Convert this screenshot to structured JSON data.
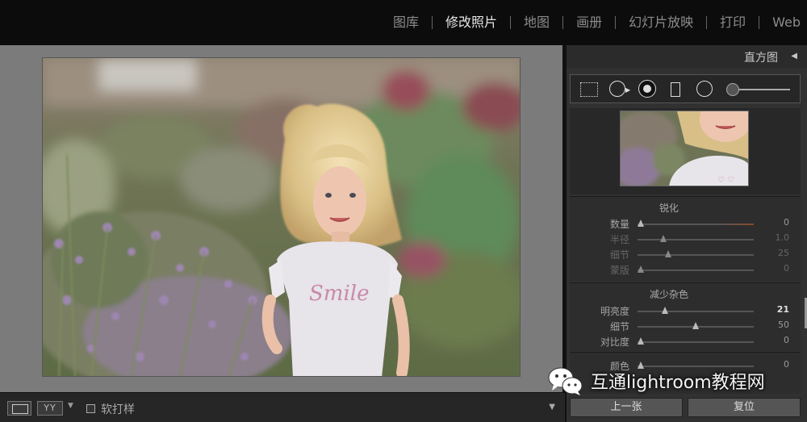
{
  "modules": [
    {
      "label": "图库",
      "active": false
    },
    {
      "label": "修改照片",
      "active": true
    },
    {
      "label": "地图",
      "active": false
    },
    {
      "label": "画册",
      "active": false
    },
    {
      "label": "幻灯片放映",
      "active": false
    },
    {
      "label": "打印",
      "active": false
    },
    {
      "label": "Web",
      "active": false
    }
  ],
  "toolbar": {
    "yy_label": "YY",
    "softproof_label": "软打样"
  },
  "panel": {
    "histogram_title": "直方图",
    "sharpen": {
      "title": "锐化",
      "rows": [
        {
          "label": "数量",
          "value": "0",
          "dim": false
        },
        {
          "label": "半径",
          "value": "1.0",
          "dim": true
        },
        {
          "label": "细节",
          "value": "25",
          "dim": true
        },
        {
          "label": "蒙版",
          "value": "0",
          "dim": true
        }
      ]
    },
    "noise": {
      "title": "减少杂色",
      "rows": [
        {
          "label": "明亮度",
          "value": "21",
          "dim": false
        },
        {
          "label": "细节",
          "value": "50",
          "dim": false
        },
        {
          "label": "对比度",
          "value": "0",
          "dim": false
        }
      ]
    },
    "color_row": {
      "label": "颜色",
      "value": "0"
    },
    "prev_button": "上一张",
    "reset_button": "复位"
  },
  "watermark": {
    "text": "互通lightroom教程网",
    "icon": "wechat-icon"
  },
  "colors": {
    "active_module": "#e6e6e6",
    "inactive_module": "#8c8c8c",
    "panel_bg": "#313131",
    "view_bg": "#7b7b7b"
  }
}
